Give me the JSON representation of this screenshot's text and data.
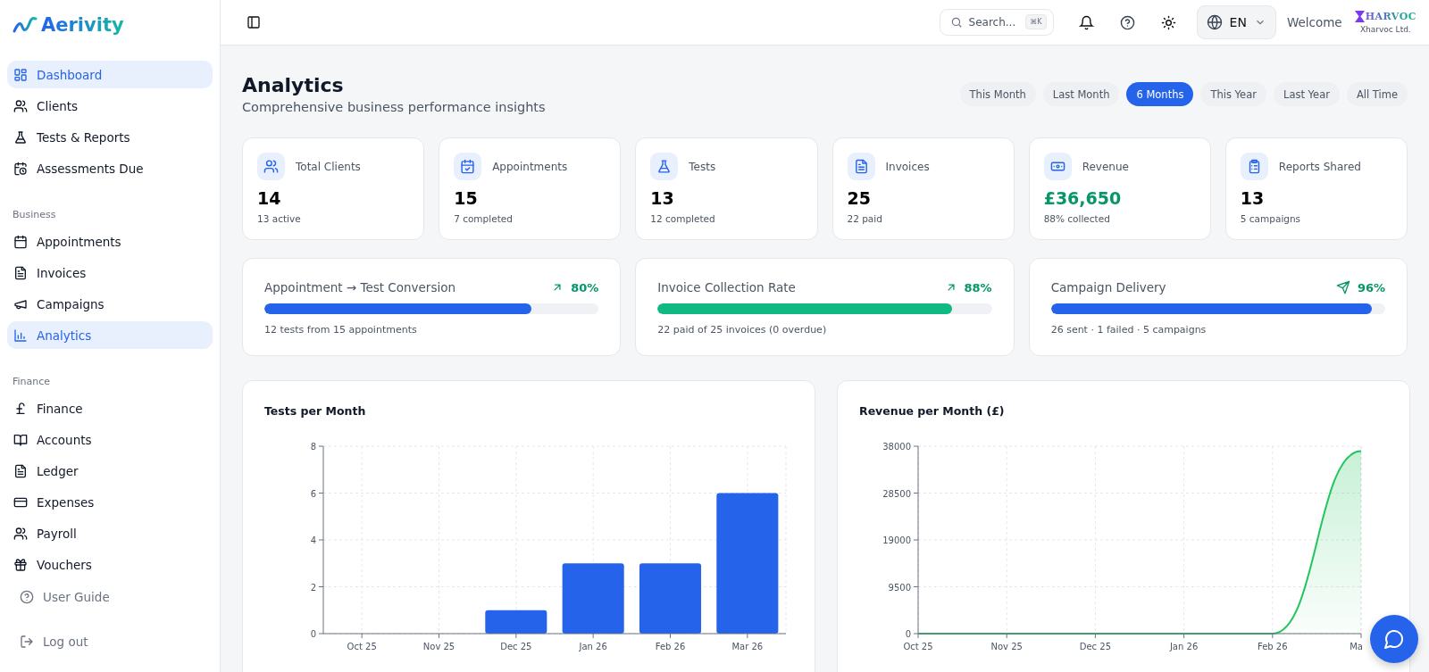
{
  "brand": {
    "name": "Aerivity"
  },
  "sidebar": {
    "sections": [
      {
        "items": [
          {
            "label": "Dashboard",
            "selected": true
          },
          {
            "label": "Clients",
            "selected": false
          },
          {
            "label": "Tests & Reports",
            "selected": false
          },
          {
            "label": "Assessments Due",
            "selected": false
          }
        ]
      },
      {
        "heading": "Business",
        "items": [
          {
            "label": "Appointments",
            "selected": false
          },
          {
            "label": "Invoices",
            "selected": false
          },
          {
            "label": "Campaigns",
            "selected": false
          },
          {
            "label": "Analytics",
            "selected": true
          }
        ]
      },
      {
        "heading": "Finance",
        "items": [
          {
            "label": "Finance",
            "selected": false
          },
          {
            "label": "Accounts",
            "selected": false
          },
          {
            "label": "Ledger",
            "selected": false
          },
          {
            "label": "Expenses",
            "selected": false
          },
          {
            "label": "Payroll",
            "selected": false
          },
          {
            "label": "Vouchers",
            "selected": false
          }
        ]
      }
    ],
    "footer": [
      {
        "label": "User Guide"
      },
      {
        "label": "Log out"
      }
    ]
  },
  "header": {
    "search": {
      "placeholder": "Search...",
      "shortcut": "⌘K"
    },
    "language": "EN",
    "welcome": "Welcome",
    "company": {
      "logo": "HARVOC",
      "name": "Xharvoc Ltd."
    }
  },
  "page": {
    "title": "Analytics",
    "subtitle": "Comprehensive business performance insights"
  },
  "periods": [
    {
      "label": "This Month",
      "selected": false
    },
    {
      "label": "Last Month",
      "selected": false
    },
    {
      "label": "6 Months",
      "selected": true
    },
    {
      "label": "This Year",
      "selected": false
    },
    {
      "label": "Last Year",
      "selected": false
    },
    {
      "label": "All Time",
      "selected": false
    }
  ],
  "stats": [
    {
      "label": "Total Clients",
      "value": "14",
      "sub": "13 active",
      "accent": false
    },
    {
      "label": "Appointments",
      "value": "15",
      "sub": "7 completed",
      "accent": false
    },
    {
      "label": "Tests",
      "value": "13",
      "sub": "12 completed",
      "accent": false
    },
    {
      "label": "Invoices",
      "value": "25",
      "sub": "22 paid",
      "accent": false
    },
    {
      "label": "Revenue",
      "value": "£36,650",
      "sub": "88% collected",
      "accent": true
    },
    {
      "label": "Reports Shared",
      "value": "13",
      "sub": "5 campaigns",
      "accent": false
    }
  ],
  "rates": [
    {
      "label": "Appointment → Test Conversion",
      "percent": "80%",
      "level": 0.8,
      "color": "#2563eb",
      "sub": "12 tests from 15 appointments"
    },
    {
      "label": "Invoice Collection Rate",
      "percent": "88%",
      "level": 0.88,
      "color": "#10b981",
      "sub": "22 paid of 25 invoices (0 overdue)"
    },
    {
      "label": "Campaign Delivery",
      "percent": "96%",
      "level": 0.96,
      "color": "#2563eb",
      "sub": "26 sent · 1 failed · 5 campaigns"
    }
  ],
  "charts": [
    {
      "chart_data": {
        "type": "bar",
        "title": "Tests per Month",
        "categories": [
          "Oct 25",
          "Nov 25",
          "Dec 25",
          "Jan 26",
          "Feb 26",
          "Mar 26"
        ],
        "series": [
          {
            "color": "#2563eb",
            "values": [
              0,
              0,
              1,
              3,
              3,
              6
            ]
          }
        ],
        "ylim": [
          0,
          8
        ],
        "yticks": [
          0,
          2,
          4,
          6,
          8
        ],
        "grid": true
      }
    },
    {
      "chart_data": {
        "type": "area",
        "title": "Revenue per Month (£)",
        "categories": [
          "Oct 25",
          "Nov 25",
          "Dec 25",
          "Jan 26",
          "Feb 26",
          "Ma"
        ],
        "series": [
          {
            "color": "#22c55e",
            "values": [
              0,
              0,
              0,
              0,
              0,
              37000
            ]
          }
        ],
        "ylim": [
          0,
          38000
        ],
        "yticks": [
          0,
          9500,
          19000,
          28500,
          38000
        ],
        "grid": true
      }
    }
  ]
}
